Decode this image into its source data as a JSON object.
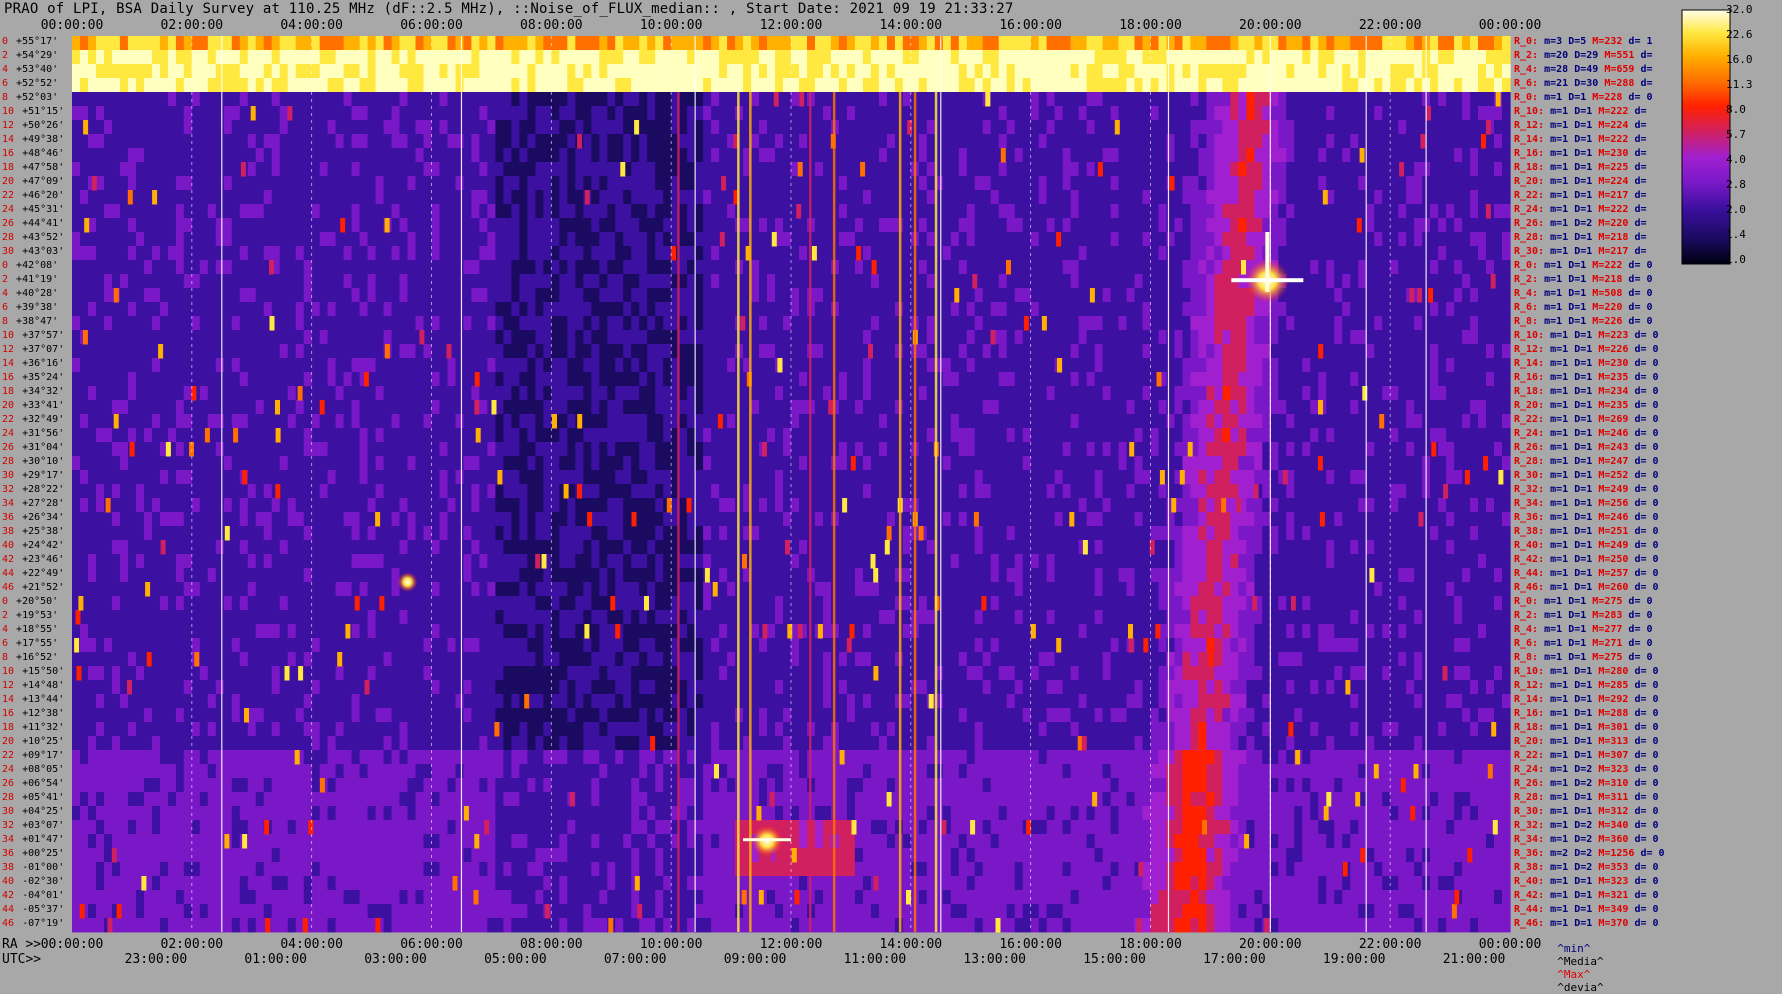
{
  "title": "PRAO of LPI, BSA Daily Survey at 110.25 MHz (dF::2.5 MHz), ::Noise_of_FLUX_median:: , Start Date: 2021 09 19 21:33:27",
  "top_axis_ticks": [
    "00:00:00",
    "02:00:00",
    "04:00:00",
    "06:00:00",
    "08:00:00",
    "10:00:00",
    "12:00:00",
    "14:00:00",
    "16:00:00",
    "18:00:00",
    "20:00:00",
    "22:00:00",
    "00:00:00"
  ],
  "ra_axis_prefix": "RA >>",
  "utc_axis_prefix": "UTC>>",
  "ra_axis_ticks": [
    "00:00:00",
    "02:00:00",
    "04:00:00",
    "06:00:00",
    "08:00:00",
    "10:00:00",
    "12:00:00",
    "14:00:00",
    "16:00:00",
    "18:00:00",
    "20:00:00",
    "22:00:00",
    "00:00:00"
  ],
  "utc_axis_ticks": [
    "23:00:00",
    "01:00:00",
    "03:00:00",
    "05:00:00",
    "07:00:00",
    "09:00:00",
    "11:00:00",
    "13:00:00",
    "15:00:00",
    "17:00:00",
    "19:00:00",
    "21:00:00"
  ],
  "legend": {
    "min": "^min^",
    "median": "^Media^",
    "max": "^Max^",
    "devia": "^devia^",
    "min_color": "#00007a",
    "median_color": "#000000",
    "max_color": "#e00000",
    "devia_color": "#000000"
  },
  "colorbar_labels": [
    "32.0",
    "22.6",
    "16.0",
    "11.3",
    "8.0",
    "5.7",
    "4.0",
    "2.8",
    "2.0",
    "1.4",
    "1.0"
  ],
  "row_labels": [
    {
      "n": "0",
      "dec": "+55°17'"
    },
    {
      "n": "2",
      "dec": "+54°29'"
    },
    {
      "n": "4",
      "dec": "+53°40'"
    },
    {
      "n": "6",
      "dec": "+52°52'"
    },
    {
      "n": "8",
      "dec": "+52°03'"
    },
    {
      "n": "10",
      "dec": "+51°15'"
    },
    {
      "n": "12",
      "dec": "+50°26'"
    },
    {
      "n": "14",
      "dec": "+49°38'"
    },
    {
      "n": "16",
      "dec": "+48°46'"
    },
    {
      "n": "18",
      "dec": "+47°58'"
    },
    {
      "n": "20",
      "dec": "+47°09'"
    },
    {
      "n": "22",
      "dec": "+46°20'"
    },
    {
      "n": "24",
      "dec": "+45°31'"
    },
    {
      "n": "26",
      "dec": "+44°41'"
    },
    {
      "n": "28",
      "dec": "+43°52'"
    },
    {
      "n": "30",
      "dec": "+43°03'"
    },
    {
      "n": "0",
      "dec": "+42°08'"
    },
    {
      "n": "2",
      "dec": "+41°19'"
    },
    {
      "n": "4",
      "dec": "+40°28'"
    },
    {
      "n": "6",
      "dec": "+39°38'"
    },
    {
      "n": "8",
      "dec": "+38°47'"
    },
    {
      "n": "10",
      "dec": "+37°57'"
    },
    {
      "n": "12",
      "dec": "+37°07'"
    },
    {
      "n": "14",
      "dec": "+36°16'"
    },
    {
      "n": "16",
      "dec": "+35°24'"
    },
    {
      "n": "18",
      "dec": "+34°32'"
    },
    {
      "n": "20",
      "dec": "+33°41'"
    },
    {
      "n": "22",
      "dec": "+32°49'"
    },
    {
      "n": "24",
      "dec": "+31°56'"
    },
    {
      "n": "26",
      "dec": "+31°04'"
    },
    {
      "n": "28",
      "dec": "+30°10'"
    },
    {
      "n": "30",
      "dec": "+29°17'"
    },
    {
      "n": "32",
      "dec": "+28°22'"
    },
    {
      "n": "34",
      "dec": "+27°28'"
    },
    {
      "n": "36",
      "dec": "+26°34'"
    },
    {
      "n": "38",
      "dec": "+25°38'"
    },
    {
      "n": "40",
      "dec": "+24°42'"
    },
    {
      "n": "42",
      "dec": "+23°46'"
    },
    {
      "n": "44",
      "dec": "+22°49'"
    },
    {
      "n": "46",
      "dec": "+21°52'"
    },
    {
      "n": "0",
      "dec": "+20°50'"
    },
    {
      "n": "2",
      "dec": "+19°53'"
    },
    {
      "n": "4",
      "dec": "+18°55'"
    },
    {
      "n": "6",
      "dec": "+17°55'"
    },
    {
      "n": "8",
      "dec": "+16°52'"
    },
    {
      "n": "10",
      "dec": "+15°50'"
    },
    {
      "n": "12",
      "dec": "+14°48'"
    },
    {
      "n": "14",
      "dec": "+13°44'"
    },
    {
      "n": "16",
      "dec": "+12°38'"
    },
    {
      "n": "18",
      "dec": "+11°32'"
    },
    {
      "n": "20",
      "dec": "+10°25'"
    },
    {
      "n": "22",
      "dec": "+09°17'"
    },
    {
      "n": "24",
      "dec": "+08°05'"
    },
    {
      "n": "26",
      "dec": "+06°54'"
    },
    {
      "n": "28",
      "dec": "+05°41'"
    },
    {
      "n": "30",
      "dec": "+04°25'"
    },
    {
      "n": "32",
      "dec": "+03°07'"
    },
    {
      "n": "34",
      "dec": "+01°47'"
    },
    {
      "n": "36",
      "dec": "+00°25'"
    },
    {
      "n": "38",
      "dec": "-01°00'"
    },
    {
      "n": "40",
      "dec": "-02°30'"
    },
    {
      "n": "42",
      "dec": "-04°01'"
    },
    {
      "n": "44",
      "dec": "-05°37'"
    },
    {
      "n": "46",
      "dec": "-07°19'"
    }
  ],
  "stats": [
    {
      "r": "R_0:",
      "m": "3",
      "D": "5",
      "M": "232",
      "d": "1"
    },
    {
      "r": "R_2:",
      "m": "20",
      "D": "29",
      "M": "551",
      "d": ""
    },
    {
      "r": "R_4:",
      "m": "28",
      "D": "49",
      "M": "659",
      "d": ""
    },
    {
      "r": "R_6:",
      "m": "21",
      "D": "30",
      "M": "288",
      "d": ""
    },
    {
      "r": "R_0:",
      "m": "1",
      "D": "1",
      "M": "228",
      "d": "0"
    },
    {
      "r": "R_10:",
      "m": "1",
      "D": "1",
      "M": "222",
      "d": ""
    },
    {
      "r": "R_12:",
      "m": "1",
      "D": "1",
      "M": "224",
      "d": ""
    },
    {
      "r": "R_14:",
      "m": "1",
      "D": "1",
      "M": "222",
      "d": ""
    },
    {
      "r": "R_16:",
      "m": "1",
      "D": "1",
      "M": "230",
      "d": ""
    },
    {
      "r": "R_18:",
      "m": "1",
      "D": "1",
      "M": "225",
      "d": ""
    },
    {
      "r": "R_20:",
      "m": "1",
      "D": "1",
      "M": "224",
      "d": ""
    },
    {
      "r": "R_22:",
      "m": "1",
      "D": "1",
      "M": "217",
      "d": ""
    },
    {
      "r": "R_24:",
      "m": "1",
      "D": "1",
      "M": "222",
      "d": ""
    },
    {
      "r": "R_26:",
      "m": "1",
      "D": "2",
      "M": "220",
      "d": ""
    },
    {
      "r": "R_28:",
      "m": "1",
      "D": "1",
      "M": "218",
      "d": ""
    },
    {
      "r": "R_30:",
      "m": "1",
      "D": "1",
      "M": "217",
      "d": ""
    },
    {
      "r": "R_0:",
      "m": "1",
      "D": "1",
      "M": "222",
      "d": "0"
    },
    {
      "r": "R_2:",
      "m": "1",
      "D": "1",
      "M": "218",
      "d": "0"
    },
    {
      "r": "R_4:",
      "m": "1",
      "D": "1",
      "M": "508",
      "d": "0"
    },
    {
      "r": "R_6:",
      "m": "1",
      "D": "1",
      "M": "220",
      "d": "0"
    },
    {
      "r": "R_8:",
      "m": "1",
      "D": "1",
      "M": "226",
      "d": "0"
    },
    {
      "r": "R_10:",
      "m": "1",
      "D": "1",
      "M": "223",
      "d": "0"
    },
    {
      "r": "R_12:",
      "m": "1",
      "D": "1",
      "M": "226",
      "d": "0"
    },
    {
      "r": "R_14:",
      "m": "1",
      "D": "1",
      "M": "230",
      "d": "0"
    },
    {
      "r": "R_16:",
      "m": "1",
      "D": "1",
      "M": "235",
      "d": "0"
    },
    {
      "r": "R_18:",
      "m": "1",
      "D": "1",
      "M": "234",
      "d": "0"
    },
    {
      "r": "R_20:",
      "m": "1",
      "D": "1",
      "M": "235",
      "d": "0"
    },
    {
      "r": "R_22:",
      "m": "1",
      "D": "1",
      "M": "269",
      "d": "0"
    },
    {
      "r": "R_24:",
      "m": "1",
      "D": "1",
      "M": "246",
      "d": "0"
    },
    {
      "r": "R_26:",
      "m": "1",
      "D": "1",
      "M": "243",
      "d": "0"
    },
    {
      "r": "R_28:",
      "m": "1",
      "D": "1",
      "M": "247",
      "d": "0"
    },
    {
      "r": "R_30:",
      "m": "1",
      "D": "1",
      "M": "252",
      "d": "0"
    },
    {
      "r": "R_32:",
      "m": "1",
      "D": "1",
      "M": "249",
      "d": "0"
    },
    {
      "r": "R_34:",
      "m": "1",
      "D": "1",
      "M": "256",
      "d": "0"
    },
    {
      "r": "R_36:",
      "m": "1",
      "D": "1",
      "M": "246",
      "d": "0"
    },
    {
      "r": "R_38:",
      "m": "1",
      "D": "1",
      "M": "251",
      "d": "0"
    },
    {
      "r": "R_40:",
      "m": "1",
      "D": "1",
      "M": "249",
      "d": "0"
    },
    {
      "r": "R_42:",
      "m": "1",
      "D": "1",
      "M": "250",
      "d": "0"
    },
    {
      "r": "R_44:",
      "m": "1",
      "D": "1",
      "M": "257",
      "d": "0"
    },
    {
      "r": "R_46:",
      "m": "1",
      "D": "1",
      "M": "260",
      "d": "0"
    },
    {
      "r": "R_0:",
      "m": "1",
      "D": "1",
      "M": "275",
      "d": "0"
    },
    {
      "r": "R_2:",
      "m": "1",
      "D": "1",
      "M": "283",
      "d": "0"
    },
    {
      "r": "R_4:",
      "m": "1",
      "D": "1",
      "M": "277",
      "d": "0"
    },
    {
      "r": "R_6:",
      "m": "1",
      "D": "1",
      "M": "271",
      "d": "0"
    },
    {
      "r": "R_8:",
      "m": "1",
      "D": "1",
      "M": "275",
      "d": "0"
    },
    {
      "r": "R_10:",
      "m": "1",
      "D": "1",
      "M": "280",
      "d": "0"
    },
    {
      "r": "R_12:",
      "m": "1",
      "D": "1",
      "M": "285",
      "d": "0"
    },
    {
      "r": "R_14:",
      "m": "1",
      "D": "1",
      "M": "292",
      "d": "0"
    },
    {
      "r": "R_16:",
      "m": "1",
      "D": "1",
      "M": "288",
      "d": "0"
    },
    {
      "r": "R_18:",
      "m": "1",
      "D": "1",
      "M": "301",
      "d": "0"
    },
    {
      "r": "R_20:",
      "m": "1",
      "D": "1",
      "M": "313",
      "d": "0"
    },
    {
      "r": "R_22:",
      "m": "1",
      "D": "1",
      "M": "307",
      "d": "0"
    },
    {
      "r": "R_24:",
      "m": "1",
      "D": "2",
      "M": "323",
      "d": "0"
    },
    {
      "r": "R_26:",
      "m": "1",
      "D": "2",
      "M": "310",
      "d": "0"
    },
    {
      "r": "R_28:",
      "m": "1",
      "D": "1",
      "M": "311",
      "d": "0"
    },
    {
      "r": "R_30:",
      "m": "1",
      "D": "1",
      "M": "312",
      "d": "0"
    },
    {
      "r": "R_32:",
      "m": "1",
      "D": "2",
      "M": "340",
      "d": "0"
    },
    {
      "r": "R_34:",
      "m": "1",
      "D": "2",
      "M": "360",
      "d": "0"
    },
    {
      "r": "R_36:",
      "m": "2",
      "D": "2",
      "M": "1256",
      "d": "0"
    },
    {
      "r": "R_38:",
      "m": "1",
      "D": "2",
      "M": "353",
      "d": "0"
    },
    {
      "r": "R_40:",
      "m": "1",
      "D": "1",
      "M": "323",
      "d": "0"
    },
    {
      "r": "R_42:",
      "m": "1",
      "D": "1",
      "M": "321",
      "d": "0"
    },
    {
      "r": "R_44:",
      "m": "1",
      "D": "1",
      "M": "349",
      "d": "0"
    },
    {
      "r": "R_46:",
      "m": "1",
      "D": "1",
      "M": "370",
      "d": "0"
    }
  ],
  "chart_data": {
    "type": "heatmap",
    "title": "PRAO of LPI, BSA Daily Survey at 110.25 MHz (dF::2.5 MHz), ::Noise_of_FLUX_median:: , Start Date: 2021 09 19 21:33:27",
    "x_axis_top": "Sidereal time 00:00:00 to 24:00:00",
    "y_axis": "Declination +55°17' to -07°19' (64 beams)",
    "colorbar_levels": [
      1.0,
      1.4,
      2.0,
      2.8,
      4.0,
      5.7,
      8.0,
      11.3,
      16.0,
      22.6,
      32.0
    ],
    "colormap": [
      "#000010",
      "#1a0a60",
      "#3c10a0",
      "#7a18c8",
      "#a020d0",
      "#d02060",
      "#ff2000",
      "#ff7000",
      "#ffb000",
      "#ffe840",
      "#ffffc0"
    ],
    "source_features": [
      {
        "label": "bright source",
        "ra": "19:59",
        "dec": "+41°19'",
        "level": 32.0
      },
      {
        "label": "galactic plane band",
        "ra": "19:00-20:30",
        "dec": "-07°19' to +47°09'",
        "level": 4.0
      },
      {
        "label": "interference band",
        "ra": "11:00-12:00",
        "dec": "+01°47' to +00°25'",
        "level": 8.0
      }
    ]
  }
}
